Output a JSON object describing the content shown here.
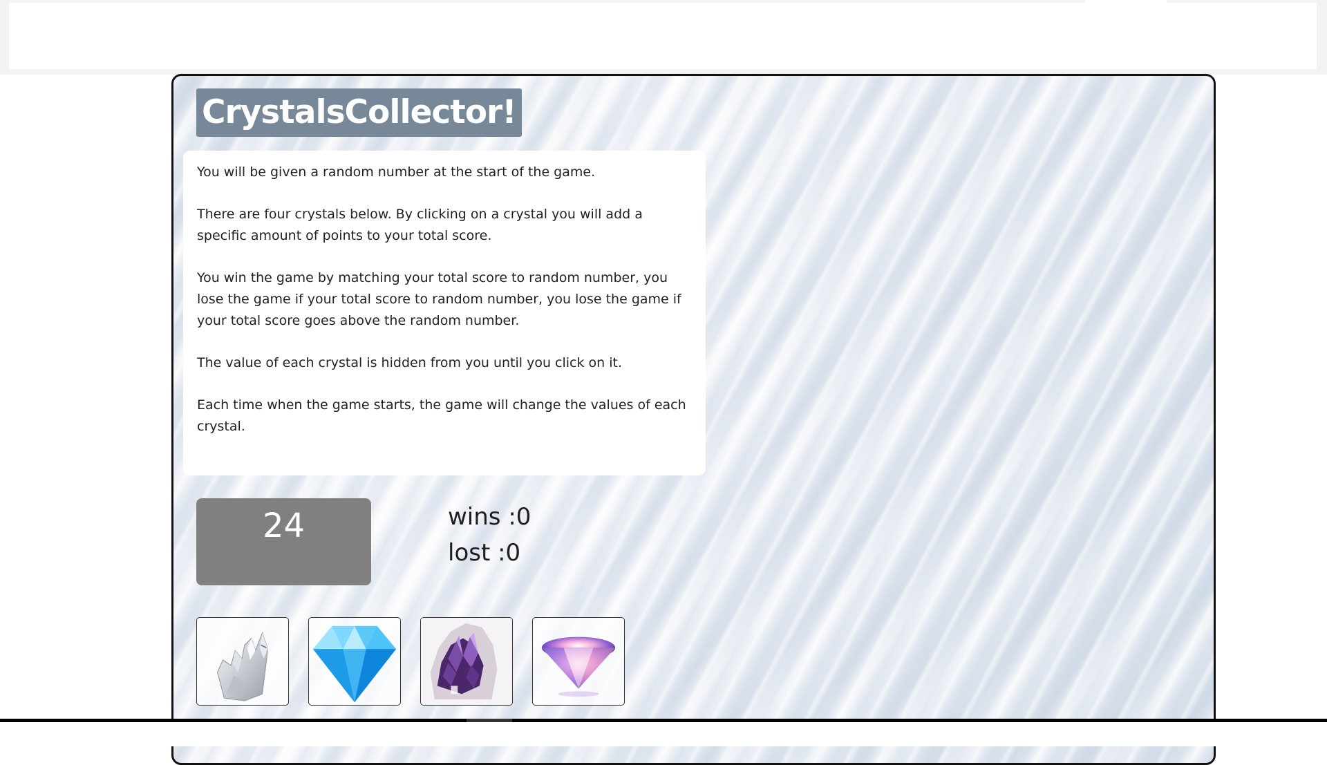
{
  "game": {
    "title": "CrystalsCollector!",
    "instructions": [
      "You will be given a random number at the start of the game.",
      "There are four crystals below. By clicking on a crystal you will add a specific amount of points to your total score.",
      "You win the game by matching your total score to random number, you lose the game if your total score to random number, you lose the game if your total score goes above the random number.",
      "The value of each crystal is hidden from you until you click on it.",
      "Each time when the game starts, the game will change the values of each crystal."
    ],
    "target_number": "24",
    "wins_label": "wins :0",
    "lost_label": "lost :0"
  },
  "crystals": [
    {
      "icon": "clear-quartz-crystal-icon"
    },
    {
      "icon": "blue-diamond-icon"
    },
    {
      "icon": "amethyst-crystal-icon"
    },
    {
      "icon": "pink-diamond-icon"
    }
  ],
  "colors": {
    "title_bg": "#778899",
    "target_bg": "#808080",
    "frame_border": "#111111"
  }
}
